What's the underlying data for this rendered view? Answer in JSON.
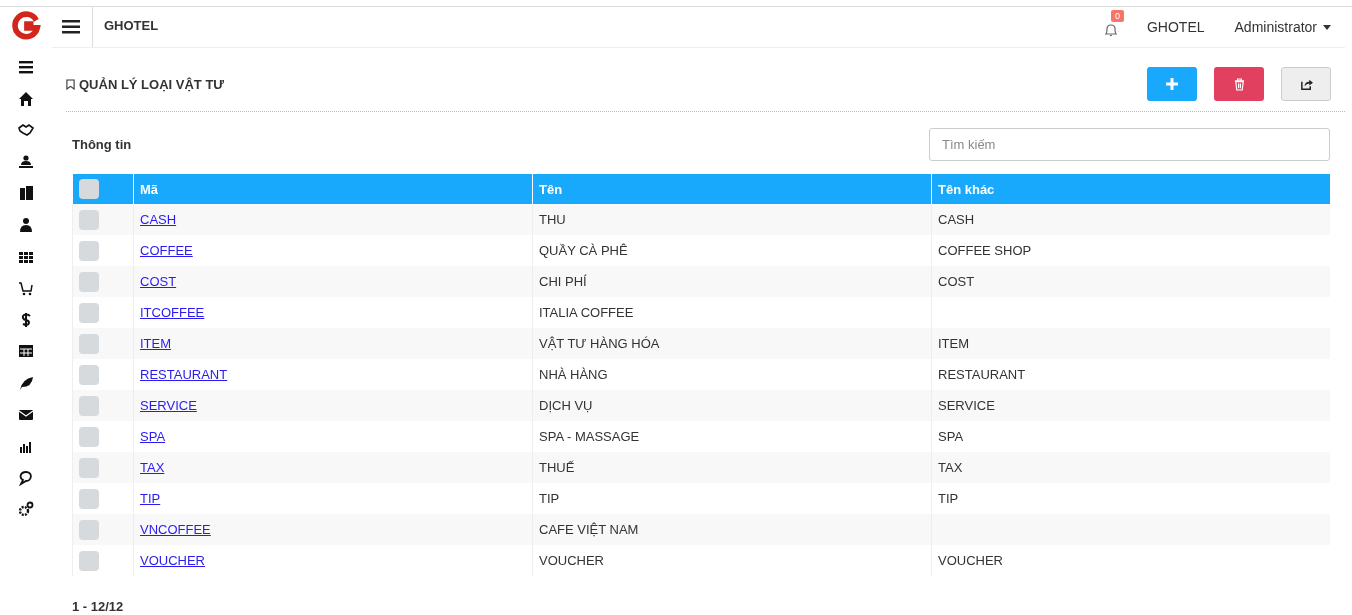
{
  "topbar": {
    "app_name": "GHOTEL",
    "notification_count": "0",
    "hotel": "GHOTEL",
    "user": "Administrator"
  },
  "page": {
    "title": "QUẢN LÝ LOẠI VẬT TƯ"
  },
  "panel": {
    "title": "Thông tin",
    "search": {
      "placeholder": "Tìm kiếm"
    }
  },
  "table": {
    "select_all_checked": false,
    "columns": [
      "Mã",
      "Tên",
      "Tên khác"
    ],
    "rows": [
      {
        "checked": false,
        "code": "CASH",
        "name": "THU",
        "other_name": "CASH"
      },
      {
        "checked": false,
        "code": "COFFEE",
        "name": "QUẦY CÀ PHÊ",
        "other_name": "COFFEE SHOP"
      },
      {
        "checked": false,
        "code": "COST",
        "name": "CHI PHÍ",
        "other_name": "COST"
      },
      {
        "checked": false,
        "code": "ITCOFFEE",
        "name": "ITALIA COFFEE",
        "other_name": ""
      },
      {
        "checked": false,
        "code": "ITEM",
        "name": "VẬT TƯ HÀNG HÓA",
        "other_name": "ITEM"
      },
      {
        "checked": false,
        "code": "RESTAURANT",
        "name": "NHÀ HÀNG",
        "other_name": "RESTAURANT"
      },
      {
        "checked": false,
        "code": "SERVICE",
        "name": "DỊCH VỤ",
        "other_name": "SERVICE"
      },
      {
        "checked": false,
        "code": "SPA",
        "name": "SPA - MASSAGE",
        "other_name": "SPA"
      },
      {
        "checked": false,
        "code": "TAX",
        "name": "THUẾ",
        "other_name": "TAX"
      },
      {
        "checked": false,
        "code": "TIP",
        "name": "TIP",
        "other_name": "TIP"
      },
      {
        "checked": false,
        "code": "VNCOFFEE",
        "name": "CAFE VIỆT NAM",
        "other_name": ""
      },
      {
        "checked": false,
        "code": "VOUCHER",
        "name": "VOUCHER",
        "other_name": "VOUCHER"
      }
    ]
  },
  "pagination": "1 - 12/12"
}
